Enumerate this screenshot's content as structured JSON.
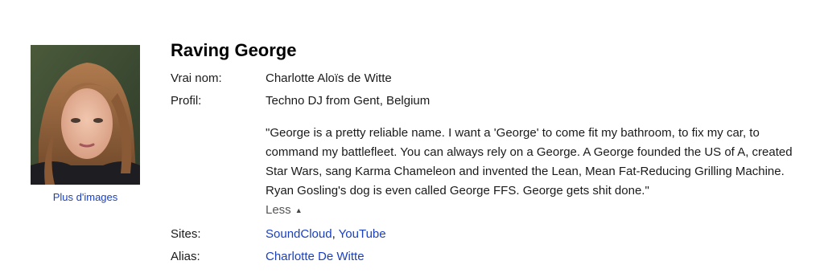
{
  "profile": {
    "name": "Raving George",
    "more_images": "Plus d'images",
    "real_name_label": "Vrai nom:",
    "real_name": "Charlotte Aloïs de Witte",
    "profile_label": "Profil:",
    "profile_text": "Techno DJ from Gent, Belgium",
    "quote": "\"George is a pretty reliable name. I want a 'George' to come fit my bathroom, to fix my car, to command my battlefleet. You can always rely on a George. A George founded the US of A, created Star Wars, sang Karma Chameleon and invented the Lean, Mean Fat-Reducing Grilling Machine. Ryan Gosling's dog is even called George FFS. George gets shit done.\"",
    "less_label": "Less",
    "sites_label": "Sites:",
    "sites": [
      "SoundCloud",
      "YouTube"
    ],
    "sites_separator": ", ",
    "alias_label": "Alias:",
    "alias": "Charlotte De Witte"
  },
  "colors": {
    "link": "#1a3fbf",
    "text": "#1a1a1a"
  }
}
